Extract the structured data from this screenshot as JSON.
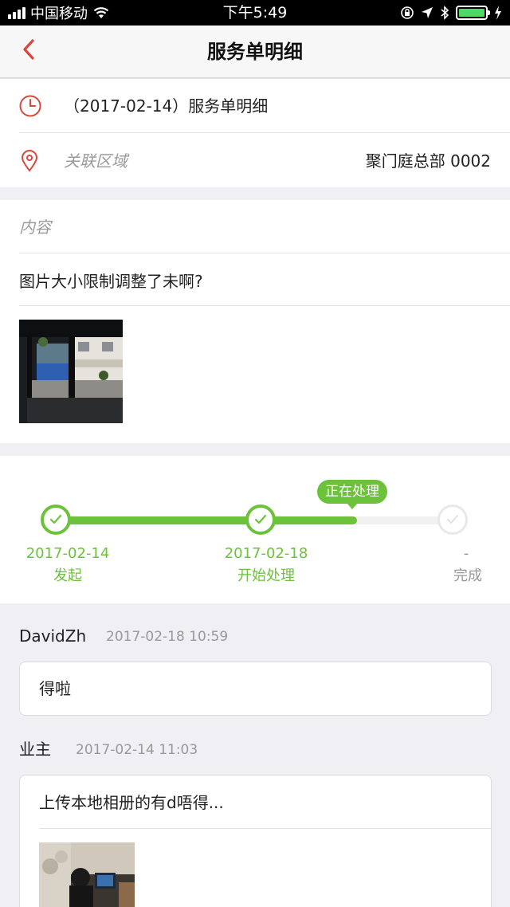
{
  "status_bar": {
    "carrier": "中国移动",
    "time": "下午5:49"
  },
  "navbar": {
    "title": "服务单明细",
    "back_icon": "chevron-left-icon",
    "accent_color": "#d9473b"
  },
  "detail": {
    "date_title": "（2017-02-14）服务单明细",
    "area_label": "关联区域",
    "area_value": "聚门庭总部 0002"
  },
  "content": {
    "label": "内容",
    "text": "图片大小限制调整了未啊?"
  },
  "progress": {
    "current_badge": "正在处理",
    "fill_fraction": 0.76,
    "active_color": "#6cc23a",
    "steps": [
      {
        "date": "2017-02-14",
        "label": "发起",
        "done": true
      },
      {
        "date": "2017-02-18",
        "label": "开始处理",
        "done": true
      },
      {
        "date": "-",
        "label": "完成",
        "done": false
      }
    ]
  },
  "comments": [
    {
      "author": "DavidZh",
      "time": "2017-02-18 10:59",
      "text": "得啦"
    },
    {
      "author": "业主",
      "time": "2017-02-14 11:03",
      "text": "上传本地相册的有d唔得..."
    }
  ]
}
